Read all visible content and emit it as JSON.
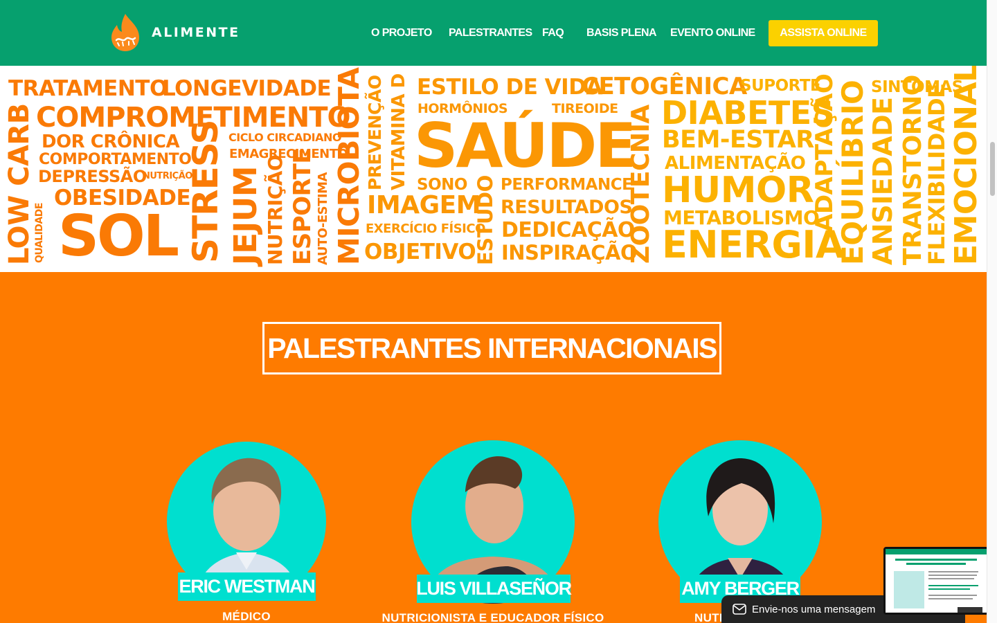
{
  "header": {
    "brand": "ALIMENTE",
    "nav": [
      {
        "label": "O PROJETO"
      },
      {
        "label": "PALESTRANTES"
      },
      {
        "label": "FAQ"
      },
      {
        "label": "BASIS PLENA"
      },
      {
        "label": "EVENTO ONLINE"
      }
    ],
    "cta": "ASSISTA ONLINE"
  },
  "word_cloud": {
    "words": [
      "TRATAMENTO",
      "LONGEVIDADE",
      "COMPROMETIMENTO",
      "DOR CRÔNICA",
      "COMPORTAMENTO",
      "DEPRESSÃO",
      "NUTRIÇÃO",
      "OBESIDADE",
      "SOL",
      "QUALIDADE",
      "LOW CARB",
      "STRESS",
      "CICLO CIRCADIANO",
      "EMAGRECIMENTO",
      "JEJUM",
      "NUTRIÇÃO",
      "ESPORTE",
      "AUTO-ESTIMA",
      "MICROBIOTA",
      "PREVENÇÃO",
      "VITAMINA D",
      "ESTILO DE VIDA",
      "HORMÔNIOS",
      "TIREOIDE",
      "SAÚDE",
      "IMAGEM",
      "SONO",
      "PERFORMANCE",
      "RESULTADOS",
      "EXERCÍCIO FÍSICO",
      "DEDICAÇÃO",
      "OBJETIVO",
      "ESTUDO",
      "INSPIRAÇÃO",
      "ZOOTECNIA",
      "CETOGÊNICA",
      "SUPORTE",
      "DIABETES",
      "BEM-ESTAR",
      "ALIMENTAÇÃO",
      "HUMOR",
      "METABOLISMO",
      "ENERGIA",
      "ADAPTAÇÃO",
      "EQUILÍBRIO",
      "SINTOMAS",
      "ANSIEDADE",
      "TRANSTORNO",
      "FLEXIBILIDADE",
      "EMOCIONAL"
    ]
  },
  "section": {
    "title": "PALESTRANTES INTERNACIONAIS"
  },
  "speakers": [
    {
      "name": "ERIC WESTMAN",
      "role": "MÉDICO"
    },
    {
      "name": "LUIS VILLASEÑOR",
      "role": "NUTRICIONISTA E EDUCADOR FÍSICO"
    },
    {
      "name": "AMY BERGER",
      "role": "NUTRI"
    }
  ],
  "chat": {
    "label": "Envie-nos uma mensagem"
  },
  "colors": {
    "header_green": "#06a06e",
    "page_orange": "#fe7b00",
    "cta_yellow": "#fbd100",
    "speaker_teal": "#00dfcf"
  }
}
